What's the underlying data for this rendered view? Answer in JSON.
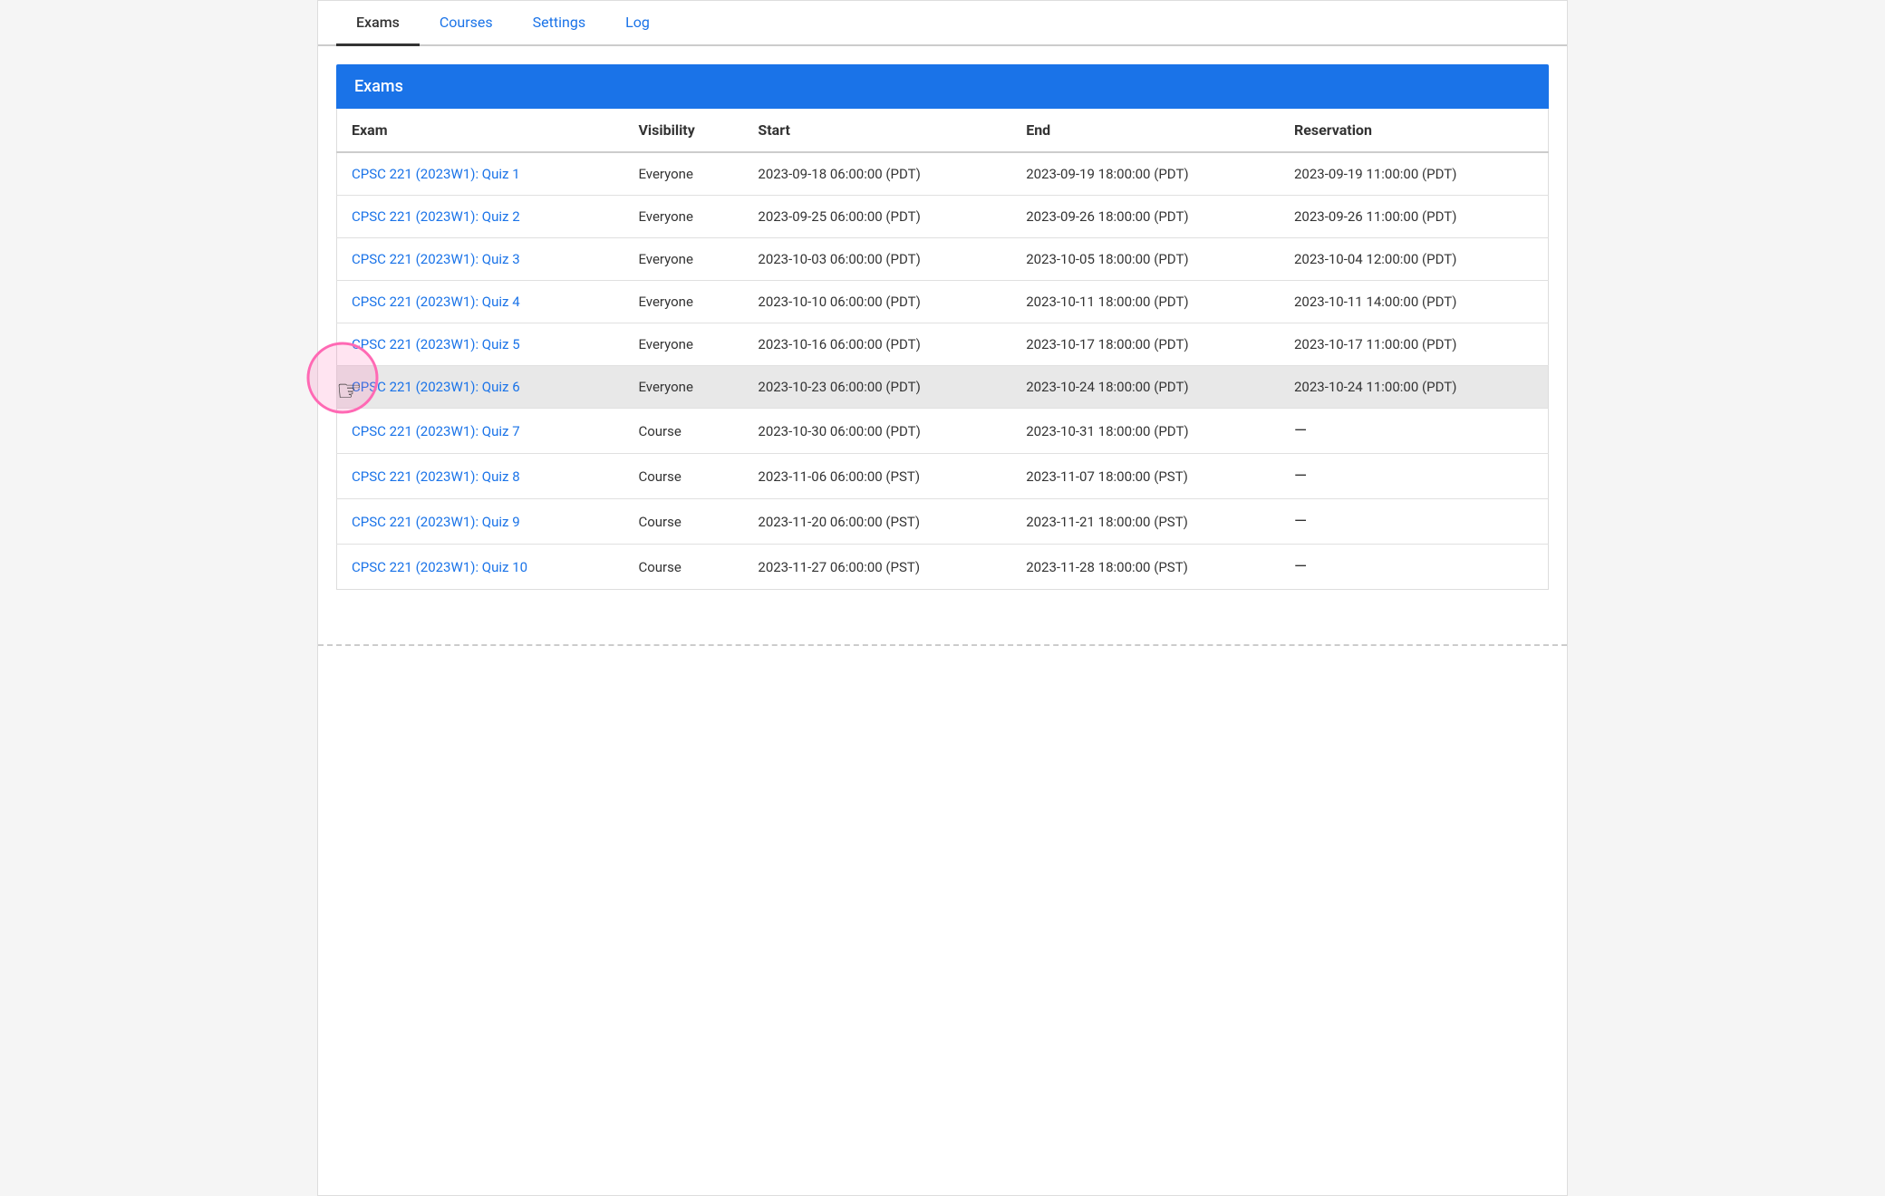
{
  "tabs": [
    {
      "id": "exams",
      "label": "Exams",
      "active": true
    },
    {
      "id": "courses",
      "label": "Courses",
      "active": false
    },
    {
      "id": "settings",
      "label": "Settings",
      "active": false
    },
    {
      "id": "log",
      "label": "Log",
      "active": false
    }
  ],
  "section": {
    "title": "Exams"
  },
  "table": {
    "columns": [
      {
        "id": "exam",
        "label": "Exam"
      },
      {
        "id": "visibility",
        "label": "Visibility"
      },
      {
        "id": "start",
        "label": "Start"
      },
      {
        "id": "end",
        "label": "End"
      },
      {
        "id": "reservation",
        "label": "Reservation"
      }
    ],
    "rows": [
      {
        "id": 1,
        "exam": "CPSC 221 (2023W1): Quiz 1",
        "visibility": "Everyone",
        "start": "2023-09-18 06:00:00 (PDT)",
        "end": "2023-09-19 18:00:00 (PDT)",
        "reservation": "2023-09-19 11:00:00 (PDT)",
        "highlighted": false,
        "cursor": false
      },
      {
        "id": 2,
        "exam": "CPSC 221 (2023W1): Quiz 2",
        "visibility": "Everyone",
        "start": "2023-09-25 06:00:00 (PDT)",
        "end": "2023-09-26 18:00:00 (PDT)",
        "reservation": "2023-09-26 11:00:00 (PDT)",
        "highlighted": false,
        "cursor": false
      },
      {
        "id": 3,
        "exam": "CPSC 221 (2023W1): Quiz 3",
        "visibility": "Everyone",
        "start": "2023-10-03 06:00:00 (PDT)",
        "end": "2023-10-05 18:00:00 (PDT)",
        "reservation": "2023-10-04 12:00:00 (PDT)",
        "highlighted": false,
        "cursor": false
      },
      {
        "id": 4,
        "exam": "CPSC 221 (2023W1): Quiz 4",
        "visibility": "Everyone",
        "start": "2023-10-10 06:00:00 (PDT)",
        "end": "2023-10-11 18:00:00 (PDT)",
        "reservation": "2023-10-11 14:00:00 (PDT)",
        "highlighted": false,
        "cursor": false
      },
      {
        "id": 5,
        "exam": "CPSC 221 (2023W1): Quiz 5",
        "visibility": "Everyone",
        "start": "2023-10-16 06:00:00 (PDT)",
        "end": "2023-10-17 18:00:00 (PDT)",
        "reservation": "2023-10-17 11:00:00 (PDT)",
        "highlighted": false,
        "cursor": false
      },
      {
        "id": 6,
        "exam": "CPSC 221 (2023W1): Quiz 6",
        "visibility": "Everyone",
        "start": "2023-10-23 06:00:00 (PDT)",
        "end": "2023-10-24 18:00:00 (PDT)",
        "reservation": "2023-10-24 11:00:00 (PDT)",
        "highlighted": true,
        "cursor": true
      },
      {
        "id": 7,
        "exam": "CPSC 221 (2023W1): Quiz 7",
        "visibility": "Course",
        "start": "2023-10-30 06:00:00 (PDT)",
        "end": "2023-10-31 18:00:00 (PDT)",
        "reservation": "—",
        "highlighted": false,
        "cursor": false
      },
      {
        "id": 8,
        "exam": "CPSC 221 (2023W1): Quiz 8",
        "visibility": "Course",
        "start": "2023-11-06 06:00:00 (PST)",
        "end": "2023-11-07 18:00:00 (PST)",
        "reservation": "—",
        "highlighted": false,
        "cursor": false
      },
      {
        "id": 9,
        "exam": "CPSC 221 (2023W1): Quiz 9",
        "visibility": "Course",
        "start": "2023-11-20 06:00:00 (PST)",
        "end": "2023-11-21 18:00:00 (PST)",
        "reservation": "—",
        "highlighted": false,
        "cursor": false
      },
      {
        "id": 10,
        "exam": "CPSC 221 (2023W1): Quiz 10",
        "visibility": "Course",
        "start": "2023-11-27 06:00:00 (PST)",
        "end": "2023-11-28 18:00:00 (PST)",
        "reservation": "—",
        "highlighted": false,
        "cursor": false
      }
    ]
  },
  "colors": {
    "header_bg": "#1a73e8",
    "header_text": "#ffffff",
    "link_color": "#1a73e8",
    "highlight_bg": "#e8e8e8",
    "tab_active_color": "#333333",
    "tab_inactive_color": "#1a73e8"
  }
}
